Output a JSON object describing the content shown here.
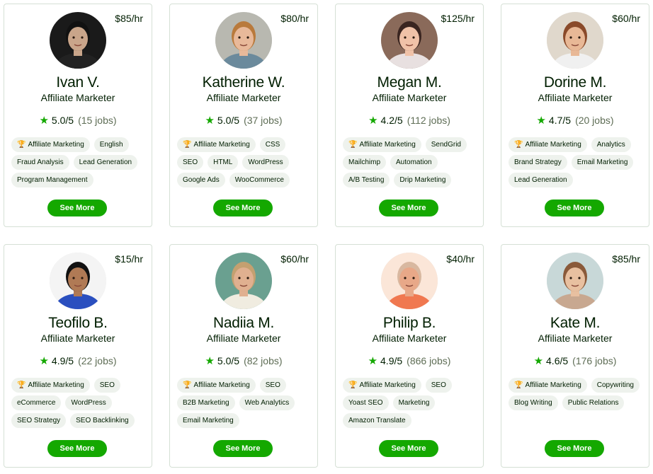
{
  "freelancers": [
    {
      "name": "Ivan V.",
      "title": "Affiliate Marketer",
      "rate": "$85/hr",
      "score": "5.0/5",
      "jobs": "(15 jobs)",
      "skills": [
        "Affiliate Marketing",
        "English",
        "Fraud Analysis",
        "Lead Generation",
        "Program Management"
      ],
      "cta": "See More"
    },
    {
      "name": "Katherine W.",
      "title": "Affiliate Marketer",
      "rate": "$80/hr",
      "score": "5.0/5",
      "jobs": "(37 jobs)",
      "skills": [
        "Affiliate Marketing",
        "CSS",
        "SEO",
        "HTML",
        "WordPress",
        "Google Ads",
        "WooCommerce"
      ],
      "cta": "See More"
    },
    {
      "name": "Megan M.",
      "title": "Affiliate Marketer",
      "rate": "$125/hr",
      "score": "4.2/5",
      "jobs": "(112 jobs)",
      "skills": [
        "Affiliate Marketing",
        "SendGrid",
        "Mailchimp",
        "Automation",
        "A/B Testing",
        "Drip Marketing"
      ],
      "cta": "See More"
    },
    {
      "name": "Dorine M.",
      "title": "Affiliate Marketer",
      "rate": "$60/hr",
      "score": "4.7/5",
      "jobs": "(20 jobs)",
      "skills": [
        "Affiliate Marketing",
        "Analytics",
        "Brand Strategy",
        "Email Marketing",
        "Lead Generation"
      ],
      "cta": "See More"
    },
    {
      "name": "Teofilo B.",
      "title": "Affiliate Marketer",
      "rate": "$15/hr",
      "score": "4.9/5",
      "jobs": "(22 jobs)",
      "skills": [
        "Affiliate Marketing",
        "SEO",
        "eCommerce",
        "WordPress",
        "SEO Strategy",
        "SEO Backlinking"
      ],
      "cta": "See More"
    },
    {
      "name": "Nadiia M.",
      "title": "Affiliate Marketer",
      "rate": "$60/hr",
      "score": "5.0/5",
      "jobs": "(82 jobs)",
      "skills": [
        "Affiliate Marketing",
        "SEO",
        "B2B Marketing",
        "Web Analytics",
        "Email Marketing"
      ],
      "cta": "See More"
    },
    {
      "name": "Philip B.",
      "title": "Affiliate Marketer",
      "rate": "$40/hr",
      "score": "4.9/5",
      "jobs": "(866 jobs)",
      "skills": [
        "Affiliate Marketing",
        "SEO",
        "Yoast SEO",
        "Marketing",
        "Amazon Translate"
      ],
      "cta": "See More"
    },
    {
      "name": "Kate M.",
      "title": "Affiliate Marketer",
      "rate": "$85/hr",
      "score": "4.6/5",
      "jobs": "(176 jobs)",
      "skills": [
        "Affiliate Marketing",
        "Copywriting",
        "Blog Writing",
        "Public Relations"
      ],
      "cta": "See More"
    }
  ],
  "avatars": [
    {
      "bg": "#1a1a1a",
      "skin": "#c9a58a",
      "hair": "#111111",
      "shirt": "#222222"
    },
    {
      "bg": "#b8b8b0",
      "skin": "#e8b99a",
      "hair": "#b97a3c",
      "shirt": "#6b8a9c"
    },
    {
      "bg": "#8a6a5a",
      "skin": "#f0c2a8",
      "hair": "#3a2520",
      "shirt": "#e8e0e0"
    },
    {
      "bg": "#e0d8cc",
      "skin": "#e8b896",
      "hair": "#8a4a2a",
      "shirt": "#f0f0f0"
    },
    {
      "bg": "#f4f4f4",
      "skin": "#b07a55",
      "hair": "#111111",
      "shirt": "#2a4fbf"
    },
    {
      "bg": "#6aa090",
      "skin": "#e0b090",
      "hair": "#c4a070",
      "shirt": "#f0ece0"
    },
    {
      "bg": "#fbe6d8",
      "skin": "#e8a888",
      "hair": "#d8b8a0",
      "shirt": "#f07850"
    },
    {
      "bg": "#c8d8d8",
      "skin": "#e8c0a0",
      "hair": "#8a5a3a",
      "shirt": "#c8a890"
    }
  ],
  "colors": {
    "accent": "#14a800",
    "chip_bg": "#eef2ed",
    "text": "#001e00",
    "muted": "#5e6d55"
  },
  "icons": {
    "star": "star-icon",
    "trophy": "trophy-icon"
  }
}
